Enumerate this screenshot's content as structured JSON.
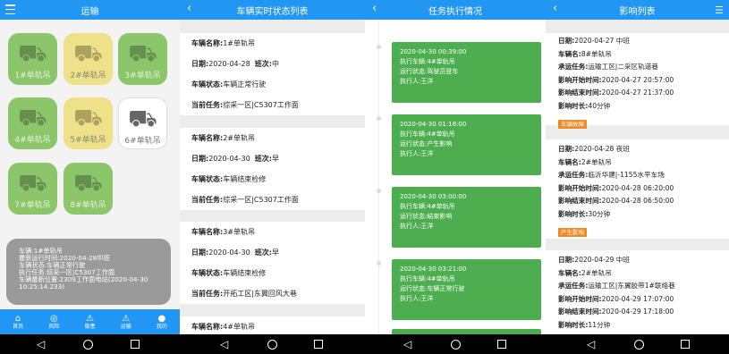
{
  "screen1": {
    "title": "运输",
    "vehicles": [
      {
        "label": "1#单轨吊",
        "color": "green"
      },
      {
        "label": "2#单轨吊",
        "color": "yellow"
      },
      {
        "label": "3#单轨吊",
        "color": "green"
      },
      {
        "label": "4#单轨吊",
        "color": "green"
      },
      {
        "label": "5#单轨吊",
        "color": "yellow"
      },
      {
        "label": "6#单轨吊",
        "color": "white"
      },
      {
        "label": "7#单轨吊",
        "color": "green"
      },
      {
        "label": "8#单轨吊",
        "color": "green"
      }
    ],
    "info": [
      "车辆:1#单轨吊",
      "最新运行时间:2020-04-28中班",
      "车辆状态:车辆正常行驶",
      "执行任务:综采一区|C5307工作面",
      "车辆最新位置:2309工作面电站(2020-04-30",
      "10:25:14.233)"
    ],
    "tabs": [
      {
        "label": "首页",
        "icon": "⌂"
      },
      {
        "label": "风险",
        "icon": "◎"
      },
      {
        "label": "隐患",
        "icon": "⚠"
      },
      {
        "label": "运输",
        "icon": "⚠"
      },
      {
        "label": "我的",
        "icon": "●"
      }
    ]
  },
  "screen2": {
    "title": "车辆实时状态列表",
    "cards": [
      {
        "name_label": "车辆名称:",
        "name": "1#单轨吊",
        "date_label": "日期:",
        "date": "2020-04-28",
        "shift_label": "班次:",
        "shift": "中",
        "status_label": "车辆状态:",
        "status": "车辆正常行驶",
        "task_label": "当前任务:",
        "task": "综采一区|C5307工作面"
      },
      {
        "name_label": "车辆名称:",
        "name": "2#单轨吊",
        "date_label": "日期:",
        "date": "2020-04-30",
        "shift_label": "班次:",
        "shift": "早",
        "status_label": "车辆状态:",
        "status": "车辆结束检修",
        "task_label": "当前任务:",
        "task": "综采一区|C5307工作面"
      },
      {
        "name_label": "车辆名称:",
        "name": "3#单轨吊",
        "date_label": "日期:",
        "date": "2020-04-30",
        "shift_label": "班次:",
        "shift": "早",
        "status_label": "车辆状态:",
        "status": "车辆结束检修",
        "task_label": "当前任务:",
        "task": "开拓工区|东翼回风大巷"
      },
      {
        "name_label": "车辆名称:",
        "name": "4#单轨吊"
      }
    ]
  },
  "screen3": {
    "title": "任务执行情况",
    "tasks": [
      {
        "time": "2020-04-30 00:39:00",
        "vehicle": "执行车辆:4#单轨吊",
        "state": "运行状态:驾驶员登车",
        "person": "执行人:王洋"
      },
      {
        "time": "2020-04-30 01:18:00",
        "vehicle": "执行车辆:4#单轨吊",
        "state": "运行状态:产生影响",
        "person": "执行人:王洋"
      },
      {
        "time": "2020-04-30 03:00:00",
        "vehicle": "执行车辆:4#单轨吊",
        "state": "运行状态:结束影响",
        "person": "执行人:王洋"
      },
      {
        "time": "2020-04-30 03:21:00",
        "vehicle": "执行车辆:4#单轨吊",
        "state": "运行状态:车辆正常行驶",
        "person": "执行人:王洋"
      }
    ]
  },
  "screen4": {
    "title": "影响列表",
    "items": [
      {
        "date_label": "日期:",
        "date": "2020-04-27  中班",
        "veh_label": "车辆名:",
        "veh": "8#单轨吊",
        "route_label": "承运任务:",
        "route": "运输工区|二采区轨道巷",
        "start_label": "影响开始时间:",
        "start": "2020-04-27 20:57:00",
        "end_label": "影响结束时间:",
        "end": "2020-04-27 21:37:00",
        "dur_label": "影响时长:",
        "dur": "40分钟",
        "tag": "车辆故障"
      },
      {
        "date_label": "日期:",
        "date": "2020-04-28  夜班",
        "veh_label": "车辆名:",
        "veh": "2#单轨吊",
        "route_label": "承运任务:",
        "route": "临沂华建|-1155水平车场",
        "start_label": "影响开始时间:",
        "start": "2020-04-28 06:20:00",
        "end_label": "影响结束时间:",
        "end": "2020-04-28 06:50:00",
        "dur_label": "影响时长:",
        "dur": "30分钟",
        "tag": "产生影响"
      },
      {
        "date_label": "日期:",
        "date": "2020-04-29  中班",
        "veh_label": "车辆名:",
        "veh": "2#单轨吊",
        "route_label": "承运任务:",
        "route": "运输工区|东翼胶带1#联络巷",
        "start_label": "影响开始时间:",
        "start": "2020-04-29 17:07:00",
        "end_label": "影响结束时间:",
        "end": "2020-04-29 17:18:00",
        "dur_label": "影响时长:",
        "dur": "11分钟"
      }
    ]
  },
  "colors": {
    "primary": "#2196f3",
    "green": "#4cae4f",
    "tile_green": "#8cc66a",
    "tile_yellow": "#eee188",
    "tag_orange": "#f08a24"
  }
}
